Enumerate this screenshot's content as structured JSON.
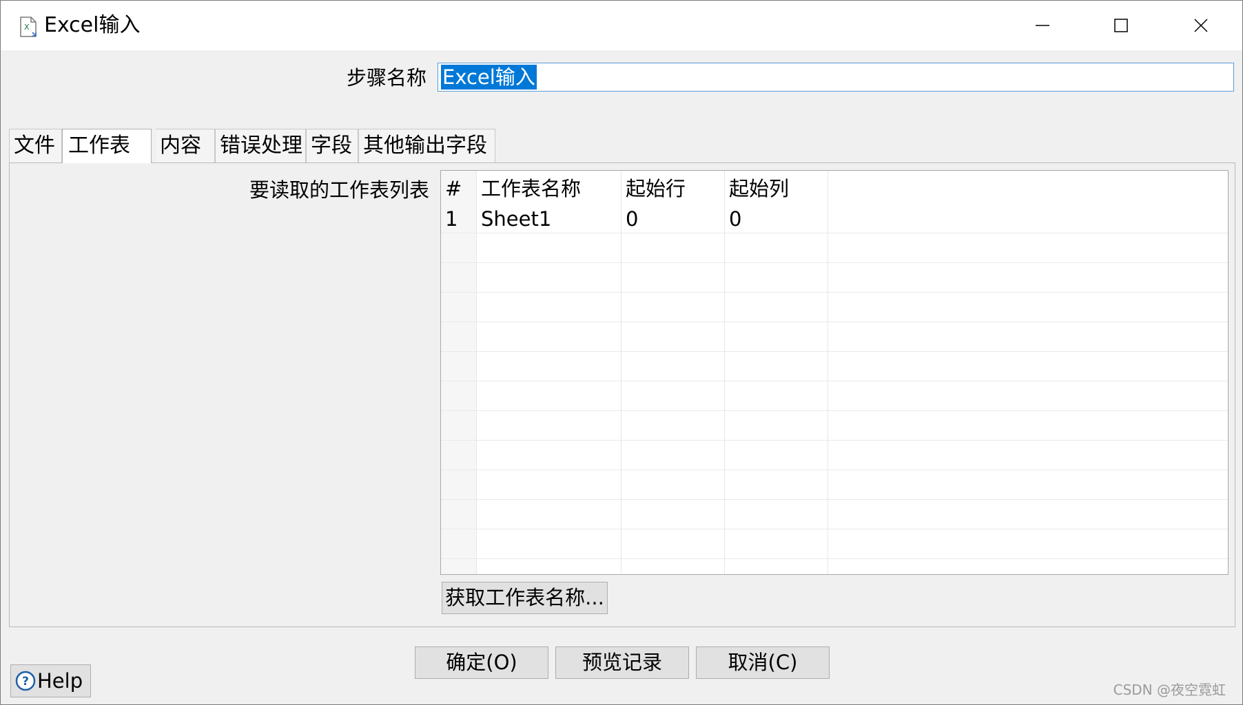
{
  "window": {
    "title": "Excel输入",
    "icon": "excel-file-icon",
    "controls": {
      "minimize": "minimize-icon",
      "maximize": "maximize-icon",
      "close": "close-icon"
    }
  },
  "step": {
    "label": "步骤名称",
    "value": "Excel输入"
  },
  "tabs": [
    {
      "label": "文件",
      "active": false
    },
    {
      "label": "工作表",
      "active": true
    },
    {
      "label": "内容",
      "active": false
    },
    {
      "label": "错误处理",
      "active": false
    },
    {
      "label": "字段",
      "active": false
    },
    {
      "label": "其他输出字段",
      "active": false
    }
  ],
  "sheets": {
    "label": "要读取的工作表列表",
    "columns": [
      "#",
      "工作表名称",
      "起始行",
      "起始列"
    ],
    "rows": [
      {
        "index": "1",
        "name": "Sheet1",
        "start_row": "0",
        "start_col": "0"
      }
    ],
    "get_button": "获取工作表名称..."
  },
  "footer": {
    "ok": "确定(O)",
    "preview": "预览记录",
    "cancel": "取消(C)",
    "help": "Help"
  },
  "watermark": "CSDN @夜空霓虹"
}
